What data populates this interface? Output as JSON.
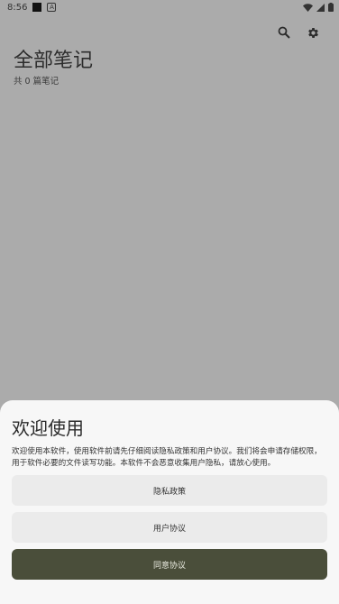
{
  "status_bar": {
    "time": "8:56"
  },
  "icons": {
    "search": "search-icon",
    "settings": "gear-icon"
  },
  "header": {
    "title": "全部笔记",
    "count_text": "共 0 篇笔记"
  },
  "sheet": {
    "title": "欢迎使用",
    "body": "欢迎使用本软件，使用软件前请先仔细阅读隐私政策和用户协议。我们将会申请存储权限，用于软件必要的文件读写功能。本软件不会恶意收集用户隐私，请放心使用。",
    "privacy_button": "隐私政策",
    "terms_button": "用户协议",
    "agree_button": "同意协议"
  },
  "colors": {
    "scrim": "#ababab",
    "sheet_bg": "#f7f7f7",
    "secondary_button": "#ebebeb",
    "primary_button": "#4a4e3a"
  }
}
